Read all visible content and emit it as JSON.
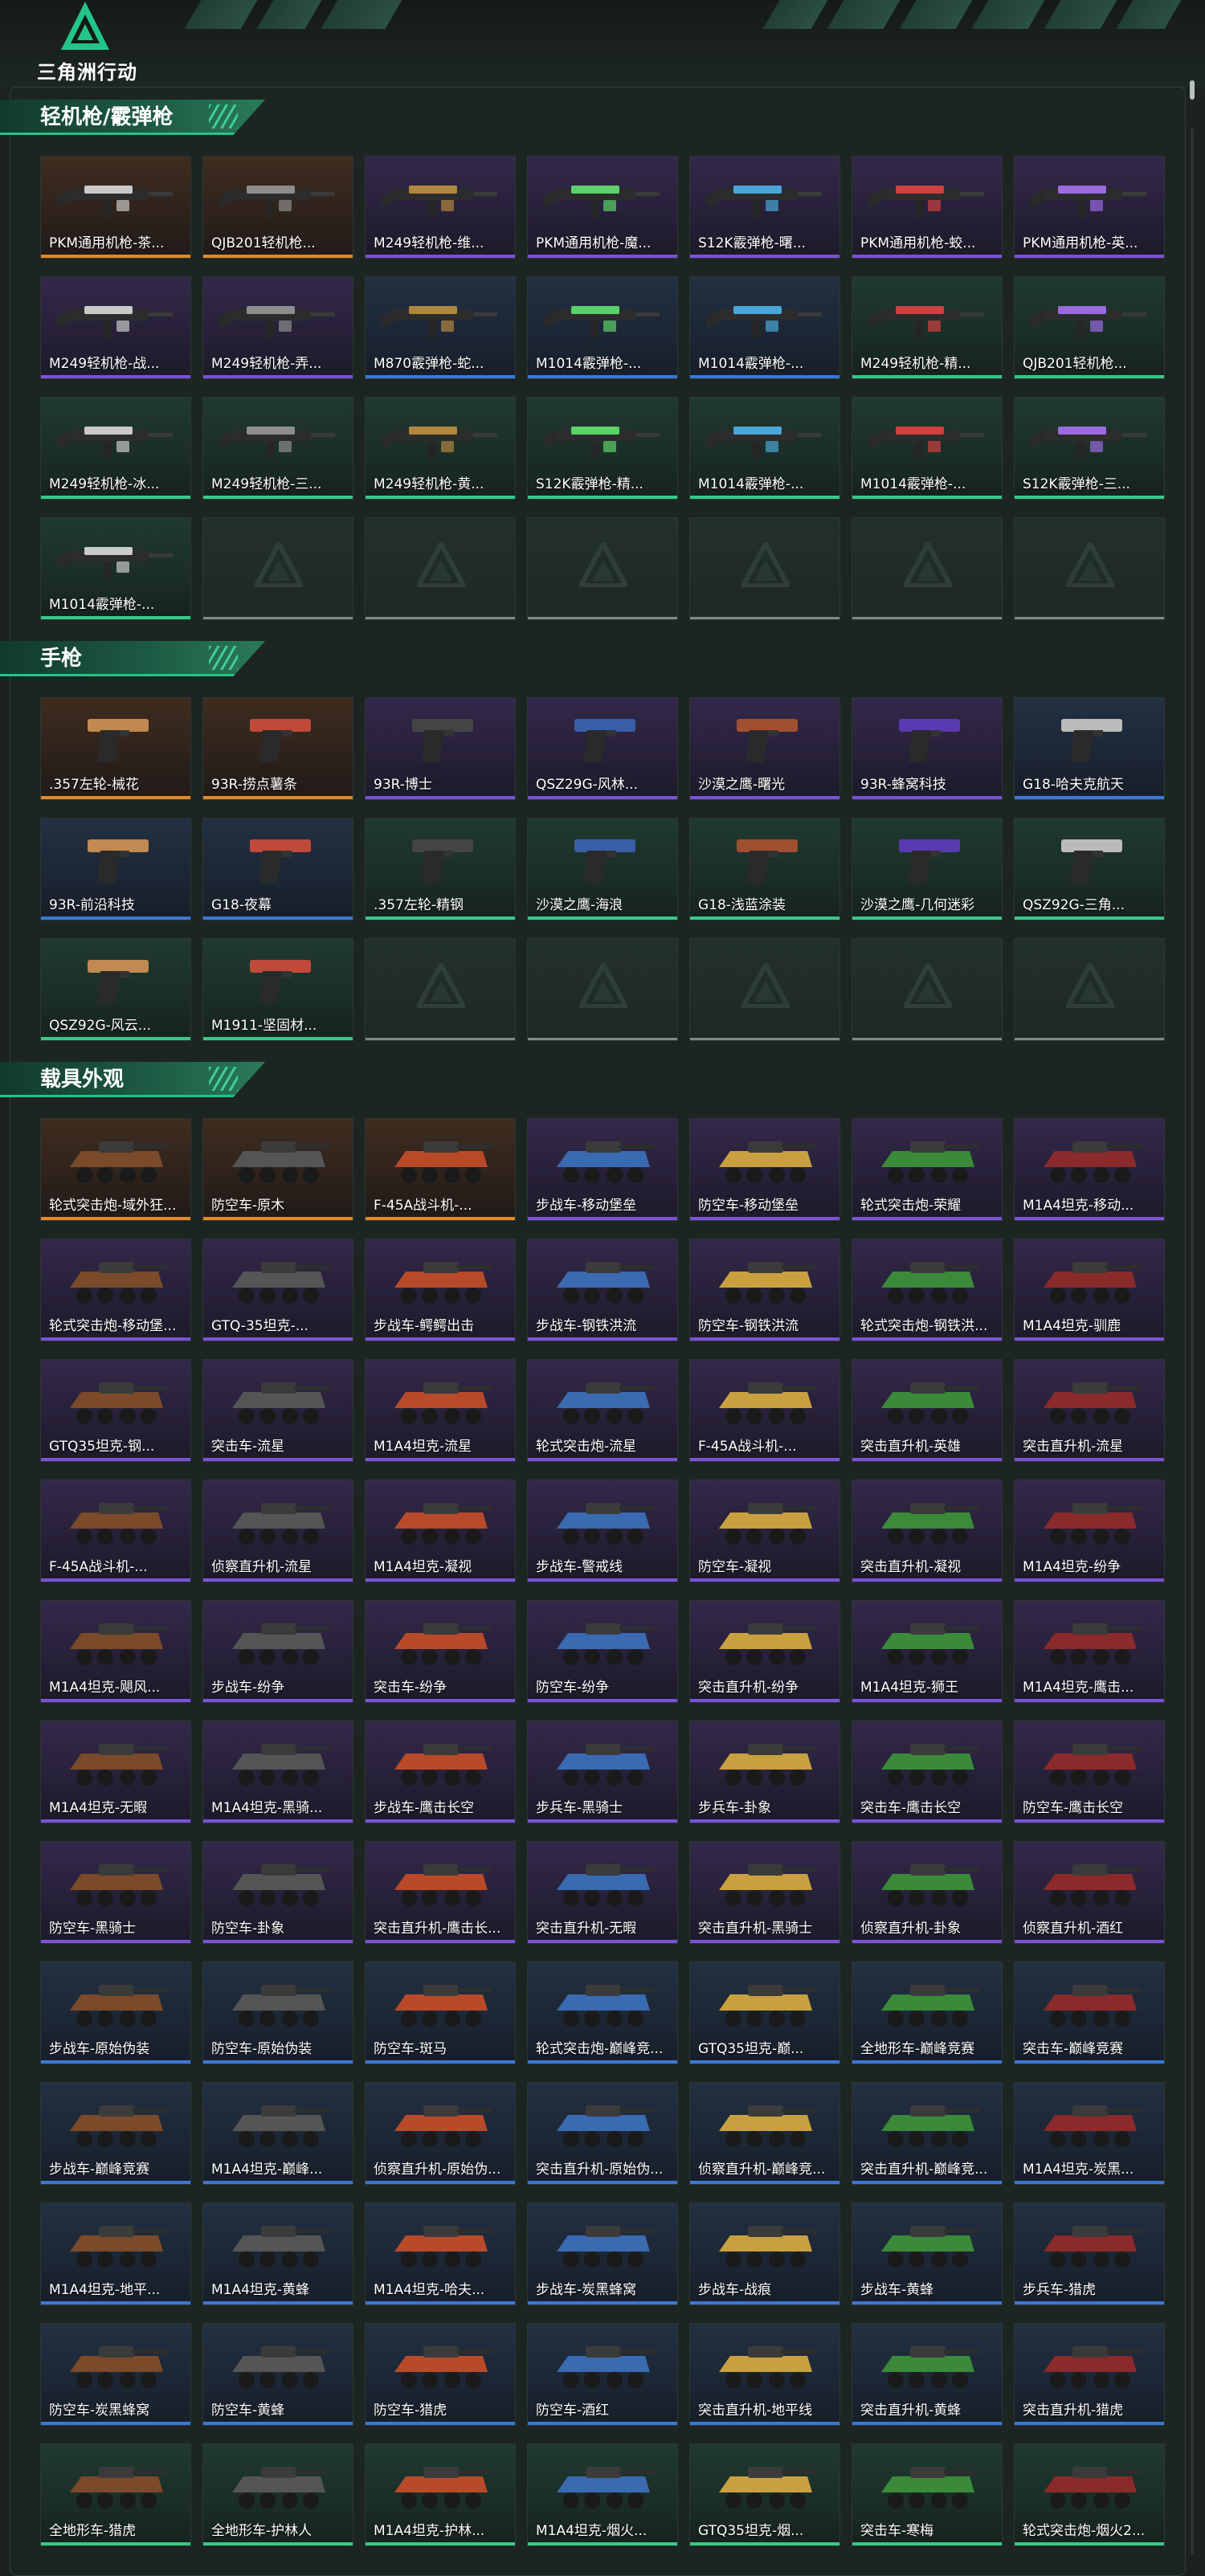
{
  "brand": {
    "logo_icon": "delta-triangle-logo-icon",
    "title": "三角洲行动",
    "accent": "#23c487"
  },
  "colors": {
    "gold": "#e08a2a",
    "purple": "#7b52d8",
    "blue": "#3a78d8",
    "green": "#36c987",
    "empty": "#7f8a86"
  },
  "sections": [
    {
      "title": "轻机枪/霰弹枪",
      "icon": "rifle-icon",
      "items": [
        {
          "name": "PKM通用机枪-茶...",
          "rarity": "gold"
        },
        {
          "name": "QJB201轻机枪...",
          "rarity": "gold"
        },
        {
          "name": "M249轻机枪-维...",
          "rarity": "purple"
        },
        {
          "name": "PKM通用机枪-魔...",
          "rarity": "purple"
        },
        {
          "name": "S12K霰弹枪-曙...",
          "rarity": "purple"
        },
        {
          "name": "PKM通用机枪-蛟...",
          "rarity": "purple"
        },
        {
          "name": "PKM通用机枪-英...",
          "rarity": "purple"
        },
        {
          "name": "M249轻机枪-战...",
          "rarity": "purple"
        },
        {
          "name": "M249轻机枪-弄...",
          "rarity": "purple"
        },
        {
          "name": "M870霰弹枪-蛇...",
          "rarity": "blue"
        },
        {
          "name": "M1014霰弹枪-...",
          "rarity": "blue"
        },
        {
          "name": "M1014霰弹枪-...",
          "rarity": "blue"
        },
        {
          "name": "M249轻机枪-精...",
          "rarity": "green"
        },
        {
          "name": "QJB201轻机枪...",
          "rarity": "green"
        },
        {
          "name": "M249轻机枪-冰...",
          "rarity": "green"
        },
        {
          "name": "M249轻机枪-三...",
          "rarity": "green"
        },
        {
          "name": "M249轻机枪-黄...",
          "rarity": "green"
        },
        {
          "name": "S12K霰弹枪-精...",
          "rarity": "green"
        },
        {
          "name": "M1014霰弹枪-...",
          "rarity": "green"
        },
        {
          "name": "M1014霰弹枪-...",
          "rarity": "green"
        },
        {
          "name": "S12K霰弹枪-三...",
          "rarity": "green"
        },
        {
          "name": "M1014霰弹枪-...",
          "rarity": "green"
        },
        {
          "name": "",
          "rarity": "empty"
        },
        {
          "name": "",
          "rarity": "empty"
        },
        {
          "name": "",
          "rarity": "empty"
        },
        {
          "name": "",
          "rarity": "empty"
        },
        {
          "name": "",
          "rarity": "empty"
        },
        {
          "name": "",
          "rarity": "empty"
        }
      ]
    },
    {
      "title": "手枪",
      "icon": "pistol-icon",
      "items": [
        {
          "name": ".357左轮-械花",
          "rarity": "gold"
        },
        {
          "name": "93R-捞点薯条",
          "rarity": "gold"
        },
        {
          "name": "93R-博士",
          "rarity": "purple"
        },
        {
          "name": "QSZ29G-风林...",
          "rarity": "purple"
        },
        {
          "name": "沙漠之鹰-曙光",
          "rarity": "purple"
        },
        {
          "name": "93R-蜂窝科技",
          "rarity": "purple"
        },
        {
          "name": "G18-哈夫克航天",
          "rarity": "blue"
        },
        {
          "name": "93R-前沿科技",
          "rarity": "blue"
        },
        {
          "name": "G18-夜幕",
          "rarity": "blue"
        },
        {
          "name": ".357左轮-精钢",
          "rarity": "green"
        },
        {
          "name": "沙漠之鹰-海浪",
          "rarity": "green"
        },
        {
          "name": "G18-浅蓝涂装",
          "rarity": "green"
        },
        {
          "name": "沙漠之鹰-几何迷彩",
          "rarity": "green"
        },
        {
          "name": "QSZ92G-三角...",
          "rarity": "green"
        },
        {
          "name": "QSZ92G-风云...",
          "rarity": "green"
        },
        {
          "name": "M1911-坚固材...",
          "rarity": "green"
        },
        {
          "name": "",
          "rarity": "empty"
        },
        {
          "name": "",
          "rarity": "empty"
        },
        {
          "name": "",
          "rarity": "empty"
        },
        {
          "name": "",
          "rarity": "empty"
        },
        {
          "name": "",
          "rarity": "empty"
        }
      ]
    },
    {
      "title": "载具外观",
      "icon": "vehicle-icon",
      "items": [
        {
          "name": "轮式突击炮-域外狂...",
          "rarity": "gold"
        },
        {
          "name": "防空车-原木",
          "rarity": "gold"
        },
        {
          "name": "F-45A战斗机-...",
          "rarity": "gold"
        },
        {
          "name": "步战车-移动堡垒",
          "rarity": "purple"
        },
        {
          "name": "防空车-移动堡垒",
          "rarity": "purple"
        },
        {
          "name": "轮式突击炮-荣耀",
          "rarity": "purple"
        },
        {
          "name": "M1A4坦克-移动...",
          "rarity": "purple"
        },
        {
          "name": "轮式突击炮-移动堡...",
          "rarity": "purple"
        },
        {
          "name": "GTQ-35坦克-...",
          "rarity": "purple"
        },
        {
          "name": "步战车-鳄鳄出击",
          "rarity": "purple"
        },
        {
          "name": "步战车-钢铁洪流",
          "rarity": "purple"
        },
        {
          "name": "防空车-钢铁洪流",
          "rarity": "purple"
        },
        {
          "name": "轮式突击炮-钢铁洪...",
          "rarity": "purple"
        },
        {
          "name": "M1A4坦克-驯鹿",
          "rarity": "purple"
        },
        {
          "name": "GTQ35坦克-钢...",
          "rarity": "purple"
        },
        {
          "name": "突击车-流星",
          "rarity": "purple"
        },
        {
          "name": "M1A4坦克-流星",
          "rarity": "purple"
        },
        {
          "name": "轮式突击炮-流星",
          "rarity": "purple"
        },
        {
          "name": "F-45A战斗机-...",
          "rarity": "purple"
        },
        {
          "name": "突击直升机-英雄",
          "rarity": "purple"
        },
        {
          "name": "突击直升机-流星",
          "rarity": "purple"
        },
        {
          "name": "F-45A战斗机-...",
          "rarity": "purple"
        },
        {
          "name": "侦察直升机-流星",
          "rarity": "purple"
        },
        {
          "name": "M1A4坦克-凝视",
          "rarity": "purple"
        },
        {
          "name": "步战车-警戒线",
          "rarity": "purple"
        },
        {
          "name": "防空车-凝视",
          "rarity": "purple"
        },
        {
          "name": "突击直升机-凝视",
          "rarity": "purple"
        },
        {
          "name": "M1A4坦克-纷争",
          "rarity": "purple"
        },
        {
          "name": "M1A4坦克-飓风...",
          "rarity": "purple"
        },
        {
          "name": "步战车-纷争",
          "rarity": "purple"
        },
        {
          "name": "突击车-纷争",
          "rarity": "purple"
        },
        {
          "name": "防空车-纷争",
          "rarity": "purple"
        },
        {
          "name": "突击直升机-纷争",
          "rarity": "purple"
        },
        {
          "name": "M1A4坦克-狮王",
          "rarity": "purple"
        },
        {
          "name": "M1A4坦克-鹰击...",
          "rarity": "purple"
        },
        {
          "name": "M1A4坦克-无暇",
          "rarity": "purple"
        },
        {
          "name": "M1A4坦克-黑骑...",
          "rarity": "purple"
        },
        {
          "name": "步战车-鹰击长空",
          "rarity": "purple"
        },
        {
          "name": "步兵车-黑骑士",
          "rarity": "purple"
        },
        {
          "name": "步兵车-卦象",
          "rarity": "purple"
        },
        {
          "name": "突击车-鹰击长空",
          "rarity": "purple"
        },
        {
          "name": "防空车-鹰击长空",
          "rarity": "purple"
        },
        {
          "name": "防空车-黑骑士",
          "rarity": "purple"
        },
        {
          "name": "防空车-卦象",
          "rarity": "purple"
        },
        {
          "name": "突击直升机-鹰击长...",
          "rarity": "purple"
        },
        {
          "name": "突击直升机-无暇",
          "rarity": "purple"
        },
        {
          "name": "突击直升机-黑骑士",
          "rarity": "purple"
        },
        {
          "name": "侦察直升机-卦象",
          "rarity": "purple"
        },
        {
          "name": "侦察直升机-酒红",
          "rarity": "purple"
        },
        {
          "name": "步战车-原始伪装",
          "rarity": "blue"
        },
        {
          "name": "防空车-原始伪装",
          "rarity": "blue"
        },
        {
          "name": "防空车-斑马",
          "rarity": "blue"
        },
        {
          "name": "轮式突击炮-巅峰竞...",
          "rarity": "blue"
        },
        {
          "name": "GTQ35坦克-巅...",
          "rarity": "blue"
        },
        {
          "name": "全地形车-巅峰竞赛",
          "rarity": "blue"
        },
        {
          "name": "突击车-巅峰竞赛",
          "rarity": "blue"
        },
        {
          "name": "步战车-巅峰竞赛",
          "rarity": "blue"
        },
        {
          "name": "M1A4坦克-巅峰...",
          "rarity": "blue"
        },
        {
          "name": "侦察直升机-原始伪...",
          "rarity": "blue"
        },
        {
          "name": "突击直升机-原始伪...",
          "rarity": "blue"
        },
        {
          "name": "侦察直升机-巅峰竞...",
          "rarity": "blue"
        },
        {
          "name": "突击直升机-巅峰竞...",
          "rarity": "blue"
        },
        {
          "name": "M1A4坦克-炭黑...",
          "rarity": "blue"
        },
        {
          "name": "M1A4坦克-地平...",
          "rarity": "blue"
        },
        {
          "name": "M1A4坦克-黄蜂",
          "rarity": "blue"
        },
        {
          "name": "M1A4坦克-哈夫...",
          "rarity": "blue"
        },
        {
          "name": "步战车-炭黑蜂窝",
          "rarity": "blue"
        },
        {
          "name": "步战车-战痕",
          "rarity": "blue"
        },
        {
          "name": "步战车-黄蜂",
          "rarity": "blue"
        },
        {
          "name": "步兵车-猎虎",
          "rarity": "blue"
        },
        {
          "name": "防空车-炭黑蜂窝",
          "rarity": "blue"
        },
        {
          "name": "防空车-黄蜂",
          "rarity": "blue"
        },
        {
          "name": "防空车-猎虎",
          "rarity": "blue"
        },
        {
          "name": "防空车-酒红",
          "rarity": "blue"
        },
        {
          "name": "突击直升机-地平线",
          "rarity": "blue"
        },
        {
          "name": "突击直升机-黄蜂",
          "rarity": "blue"
        },
        {
          "name": "突击直升机-猎虎",
          "rarity": "blue"
        },
        {
          "name": "全地形车-猎虎",
          "rarity": "green"
        },
        {
          "name": "全地形车-护林人",
          "rarity": "green"
        },
        {
          "name": "M1A4坦克-护林...",
          "rarity": "green"
        },
        {
          "name": "M1A4坦克-烟火...",
          "rarity": "green"
        },
        {
          "name": "GTQ35坦克-烟...",
          "rarity": "green"
        },
        {
          "name": "突击车-寒梅",
          "rarity": "green"
        },
        {
          "name": "轮式突击炮-烟火2...",
          "rarity": "green"
        }
      ]
    }
  ]
}
